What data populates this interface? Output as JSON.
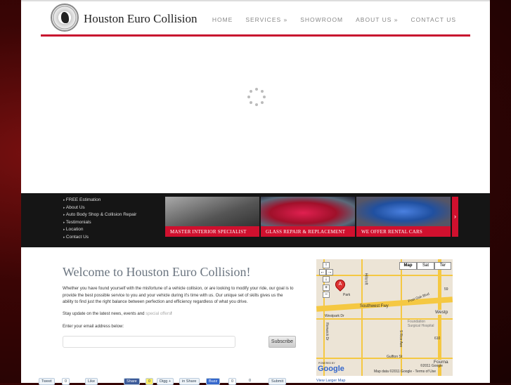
{
  "header": {
    "brand": "Houston Euro Collision",
    "nav": [
      "HOME",
      "SERVICES »",
      "SHOWROOM",
      "ABOUT US »",
      "CONTACT US"
    ]
  },
  "quick_links": [
    "FREE Estimation",
    "About Us",
    "Auto Body Shop & Collision Repair",
    "Testimonials",
    "Location",
    "Contact Us"
  ],
  "slides": [
    "MASTER INTERIOR SPECIALIST",
    "GLASS REPAIR & REPLACEMENT",
    "WE OFFER RENTAL CARS"
  ],
  "slider_next": "›",
  "main": {
    "title": "Welcome to Houston Euro Collision!",
    "intro": "Whether you have found yourself with the misfortune of a vehicle collision, or are looking to modify your ride, our goal is to provide the best possible service to you and your vehicle during it's time with us. Our unique set of skills gives us the ability to find just the right balance between perfection and efficiency regardless of what you drive.",
    "stay_prefix": "Stay update on the latest news, events and ",
    "stay_link": "special offers",
    "stay_suffix": "!",
    "email_label": "Enter your email address below:",
    "email_value": "",
    "subscribe": "Subscribe"
  },
  "map": {
    "types": [
      "Map",
      "Sat",
      "Ter"
    ],
    "labels": [
      "Southwest Fwy",
      "Westpark Dr",
      "Post Oak Blvd",
      "Foundation Surgical Hospital",
      "Gulfton St",
      "Renwick Dr",
      "S Rice Ave",
      "Hillcroft",
      "Park",
      "59",
      "610",
      "Westp",
      "Fourna"
    ],
    "attribution": "Map data ©2011 Google - Terms of Use",
    "copyright": "©2011 Google",
    "powered": "POWERED BY",
    "google": "Google",
    "larger": "View Larger Map",
    "controls": [
      "↑",
      "←",
      "→",
      "↓",
      "+",
      "−"
    ]
  },
  "social": [
    {
      "label": "Tweet"
    },
    {
      "label": "0"
    },
    {
      "label": "Like"
    },
    {
      "label": "Share"
    },
    {
      "label": "0"
    },
    {
      "label": "Digg +"
    },
    {
      "label": "in Share"
    },
    {
      "label": "Buzz"
    },
    {
      "label": "0"
    },
    {
      "label": "0"
    },
    {
      "label": "Submit"
    }
  ],
  "colors": {
    "accent": "#c8102e"
  }
}
